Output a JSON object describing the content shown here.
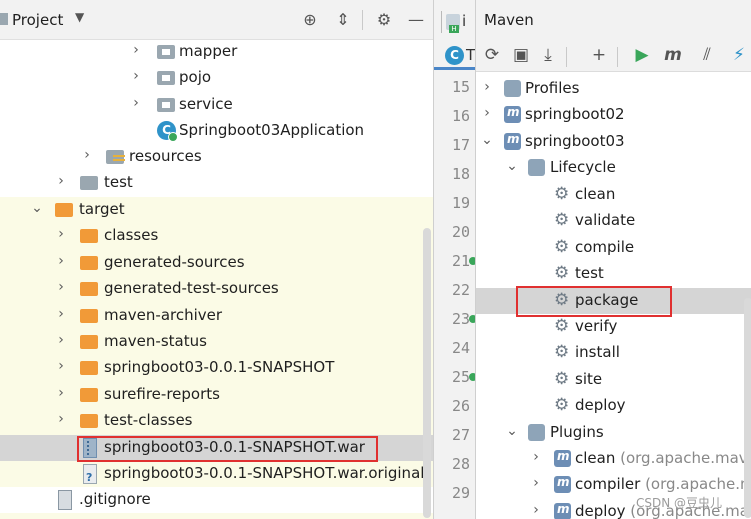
{
  "project": {
    "title": "Project",
    "tree": [
      {
        "label": "mapper",
        "kind": "package",
        "expanded": false
      },
      {
        "label": "pojo",
        "kind": "package",
        "expanded": false
      },
      {
        "label": "service",
        "kind": "package",
        "expanded": false
      },
      {
        "label": "Springboot03Application",
        "kind": "class"
      },
      {
        "label": "resources",
        "kind": "resources",
        "expanded": false
      },
      {
        "label": "test",
        "kind": "folder",
        "expanded": false
      },
      {
        "label": "target",
        "kind": "folder-orange",
        "expanded": true
      },
      {
        "label": "classes",
        "kind": "folder-orange",
        "expanded": false
      },
      {
        "label": "generated-sources",
        "kind": "folder-orange",
        "expanded": false
      },
      {
        "label": "generated-test-sources",
        "kind": "folder-orange",
        "expanded": false
      },
      {
        "label": "maven-archiver",
        "kind": "folder-orange",
        "expanded": false
      },
      {
        "label": "maven-status",
        "kind": "folder-orange",
        "expanded": false
      },
      {
        "label": "springboot03-0.0.1-SNAPSHOT",
        "kind": "folder-orange",
        "expanded": false
      },
      {
        "label": "surefire-reports",
        "kind": "folder-orange",
        "expanded": false
      },
      {
        "label": "test-classes",
        "kind": "folder-orange",
        "expanded": false
      },
      {
        "label": "springboot03-0.0.1-SNAPSHOT.war",
        "kind": "war",
        "selected": true
      },
      {
        "label": "springboot03-0.0.1-SNAPSHOT.war.original",
        "kind": "unknown-file"
      },
      {
        "label": ".gitignore",
        "kind": "file"
      }
    ]
  },
  "editor": {
    "tab_fragment": "i",
    "line_numbers": [
      "15",
      "16",
      "17",
      "18",
      "19",
      "20",
      "21",
      "22",
      "23",
      "24",
      "25",
      "26",
      "27",
      "28",
      "29"
    ]
  },
  "maven": {
    "title": "Maven",
    "tree": [
      {
        "label": "Profiles",
        "kind": "profiles",
        "expanded": false
      },
      {
        "label": "springboot02",
        "kind": "project",
        "expanded": false
      },
      {
        "label": "springboot03",
        "kind": "project",
        "expanded": true
      },
      {
        "label": "Lifecycle",
        "kind": "lifecycle",
        "expanded": true
      },
      {
        "label": "clean",
        "kind": "goal"
      },
      {
        "label": "validate",
        "kind": "goal"
      },
      {
        "label": "compile",
        "kind": "goal"
      },
      {
        "label": "test",
        "kind": "goal"
      },
      {
        "label": "package",
        "kind": "goal",
        "selected": true
      },
      {
        "label": "verify",
        "kind": "goal"
      },
      {
        "label": "install",
        "kind": "goal"
      },
      {
        "label": "site",
        "kind": "goal"
      },
      {
        "label": "deploy",
        "kind": "goal"
      },
      {
        "label": "Plugins",
        "kind": "lifecycle",
        "expanded": true
      },
      {
        "label": "clean",
        "kind": "plugin",
        "detail": "(org.apache.maven"
      },
      {
        "label": "compiler",
        "kind": "plugin",
        "detail": "(org.apache.mav"
      },
      {
        "label": "deploy",
        "kind": "plugin",
        "detail": "(org.apache.mav"
      }
    ]
  },
  "watermark": "CSDN @豆虫儿",
  "colors": {
    "highlight_box": "#e03030",
    "folder_orange": "#f19a38",
    "target_bg": "#fbfbe6",
    "selection": "#d5d5d5"
  }
}
